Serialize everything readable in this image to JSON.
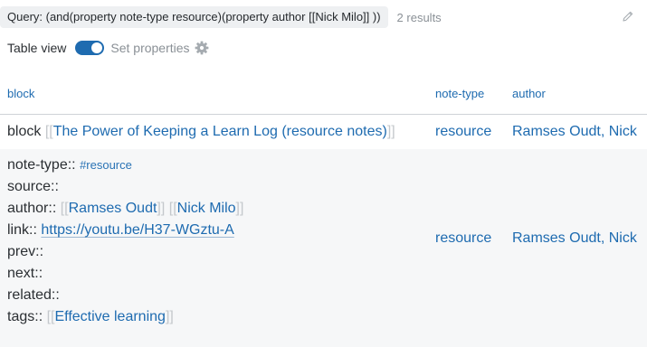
{
  "query": {
    "text": "Query: (and(property note-type resource)(property author [[Nick Milo]] ))",
    "results": "2 results"
  },
  "controls": {
    "table_view_label": "Table view",
    "table_view_on": true,
    "set_properties_label": "Set properties"
  },
  "table": {
    "headers": {
      "block": "block",
      "note_type": "note-type",
      "author": "author"
    },
    "rows": [
      {
        "block_prefix": "block",
        "block_open": "[[",
        "block_link": "The Power of Keeping a Learn Log (resource notes)",
        "block_close": "]]",
        "note_type": "resource",
        "author": "Ramses Oudt, Nick"
      },
      {
        "props": {
          "note_type_key": "note-type::",
          "note_type_tag": "#resource",
          "source_key": "source::",
          "author_key": "author::",
          "author_open1": "[[",
          "author_link1": "Ramses Oudt",
          "author_close1": "]]",
          "author_open2": "[[",
          "author_link2": "Nick Milo",
          "author_close2": "]]",
          "link_key": "link::",
          "link_url": "https://youtu.be/H37-WGztu-A",
          "prev_key": "prev::",
          "next_key": "next::",
          "related_key": "related::",
          "tags_key": "tags::",
          "tags_open": "[[",
          "tags_link": "Effective learning",
          "tags_close": "]]"
        },
        "note_type": "resource",
        "author": "Ramses Oudt, Nick"
      }
    ]
  },
  "colors": {
    "accent": "#1e6bb0",
    "muted": "#8a9096",
    "row_alt_bg": "#f6f7f8"
  },
  "icons": {
    "edit": "pencil-icon",
    "settings": "gear-icon"
  }
}
